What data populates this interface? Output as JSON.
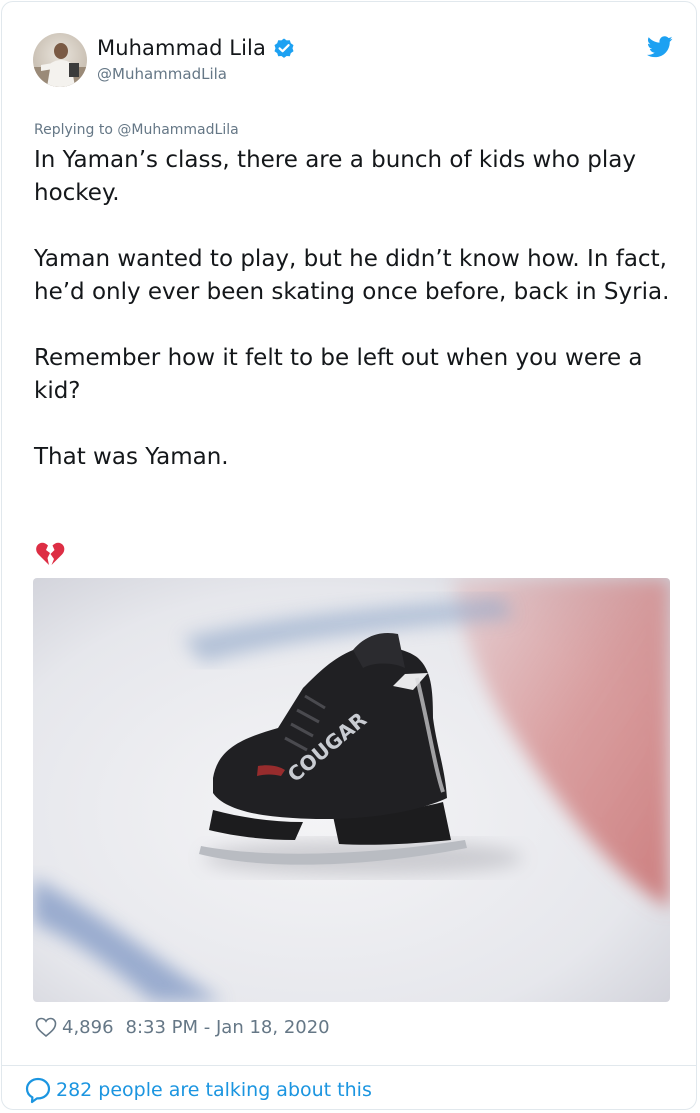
{
  "author": {
    "display_name": "Muhammad Lila",
    "handle": "@MuhammadLila",
    "avatar_icon": "avatar",
    "verified_icon": "verified-badge-icon",
    "brand_icon": "twitter-bird-icon"
  },
  "reply": {
    "text": "Replying to @MuhammadLila"
  },
  "tweet": {
    "paragraphs": [
      "In Yaman’s class, there are a bunch of kids who play hockey.",
      "Yaman wanted to play, but he didn’t know how.  In fact, he’d only ever been skating once before, back in Syria.",
      "Remember how it felt to be left out when you were a kid?",
      "That was Yaman."
    ],
    "emoji_icon": "broken-heart-icon"
  },
  "media": {
    "image_icon": "ice-skate-photo",
    "skate_brand_text": "COUGAR"
  },
  "meta": {
    "likes": "4,896",
    "timestamp": "8:33 PM - Jan 18, 2020",
    "heart_icon": "heart-icon"
  },
  "footer": {
    "talking_text": "282 people are talking about this",
    "bubble_icon": "speech-bubble-icon"
  },
  "colors": {
    "text": "#14171a",
    "secondary": "#657786",
    "accent": "#1b95e0",
    "verified": "#1da1f2",
    "border": "#e1e8ed",
    "broken_heart": "#dd2e44"
  }
}
